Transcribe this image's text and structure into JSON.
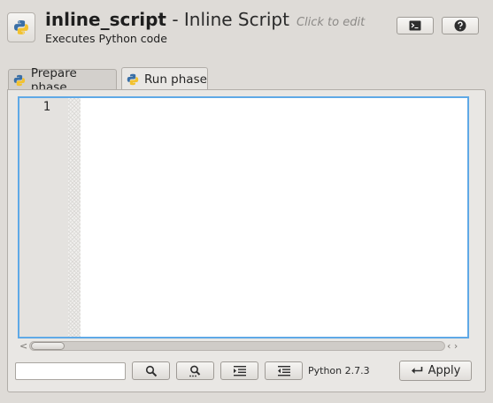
{
  "header": {
    "name": "inline_script",
    "separator": " - ",
    "type": "Inline Script",
    "edit_hint": "Click to edit",
    "description": "Executes Python code",
    "icon": "python-logo-icon",
    "console_button_icon": "terminal-icon",
    "help_button_icon": "help-icon"
  },
  "tabs": [
    {
      "label": "Prepare phase",
      "icon": "python-logo-icon",
      "active": false
    },
    {
      "label": "Run phase",
      "icon": "python-logo-icon",
      "active": true
    }
  ],
  "editor": {
    "line_numbers": [
      "1"
    ],
    "content": "",
    "focus_color": "#5fa9e6"
  },
  "scrollbar": {
    "left_arrow": "<",
    "right_arrow": "‹ ›"
  },
  "toolbar": {
    "search_value": "",
    "buttons": [
      "search-icon",
      "search-next-icon",
      "indent-icon",
      "unindent-icon"
    ],
    "python_version": "Python 2.7.3",
    "apply_label": "Apply",
    "apply_icon": "return-arrow-icon"
  }
}
